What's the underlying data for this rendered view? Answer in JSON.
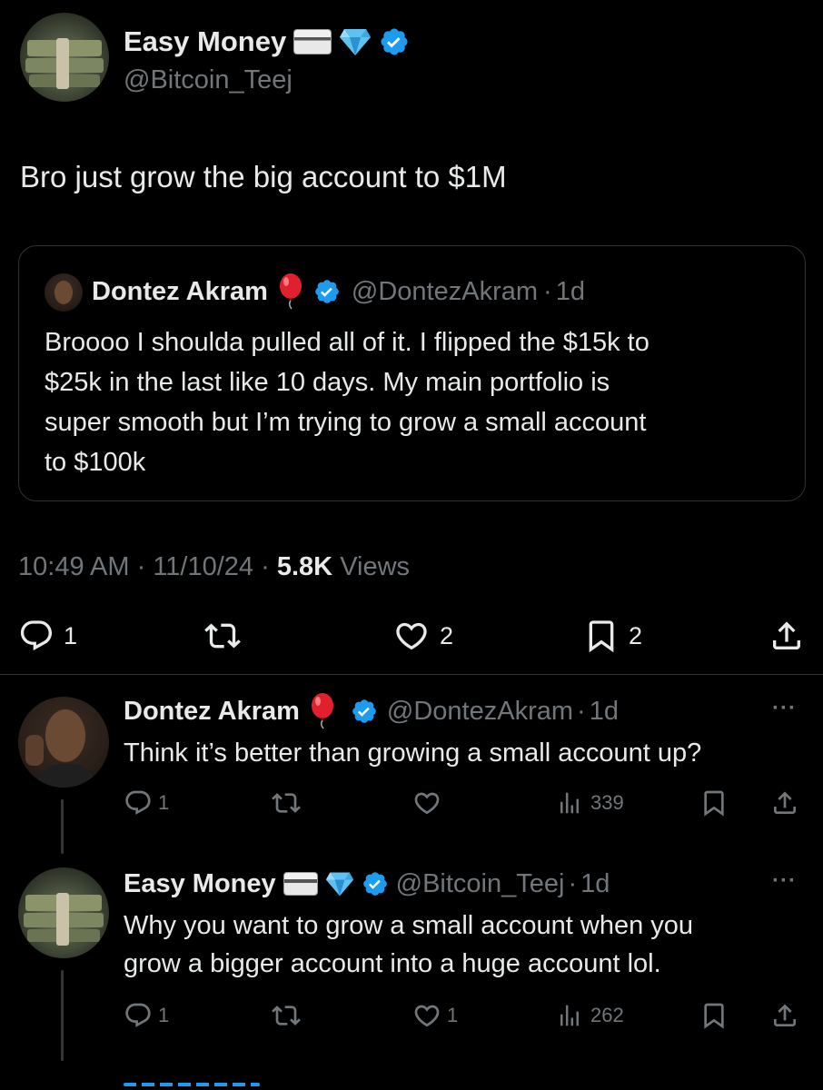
{
  "main_tweet": {
    "name": "Easy Money",
    "handle": "@Bitcoin_Teej",
    "text": "Bro just grow the big account to $1M",
    "time": "10:49 AM",
    "date": "11/10/24",
    "views_count": "5.8K",
    "views_label": "Views",
    "replies": "1",
    "likes": "2",
    "bookmarks": "2"
  },
  "quoted_tweet": {
    "name": "Dontez Akram",
    "handle": "@DontezAkram",
    "age": "1d",
    "text_lines": [
      "Broooo I shoulda pulled all of it. I flipped the $15k to",
      "$25k in the last like 10 days. My main portfolio is",
      "super smooth but I’m trying to grow a small account",
      "to $100k"
    ]
  },
  "replies": [
    {
      "name": "Dontez Akram",
      "handle": "@DontezAkram",
      "age": "1d",
      "text_lines": [
        "Think it’s better than growing a small account up?"
      ],
      "replies": "1",
      "likes": "",
      "views": "339"
    },
    {
      "name": "Easy Money",
      "handle": "@Bitcoin_Teej",
      "age": "1d",
      "text_lines": [
        "Why you want to grow a small account when you",
        "grow a bigger account into a huge account lol."
      ],
      "replies": "1",
      "likes": "1",
      "views": "262"
    }
  ],
  "separator": "·",
  "more": "···",
  "colors": {
    "background": "#000000",
    "text": "#e7e9ea",
    "muted": "#71767b",
    "verified": "#1d9bf0",
    "divider": "#2f3336"
  },
  "icons": [
    "reply-icon",
    "retweet-icon",
    "like-icon",
    "bookmark-icon",
    "share-icon",
    "views-icon",
    "verified-badge-icon",
    "credit-card-emoji-icon",
    "diamond-emoji-icon",
    "balloon-emoji-icon",
    "more-icon"
  ]
}
